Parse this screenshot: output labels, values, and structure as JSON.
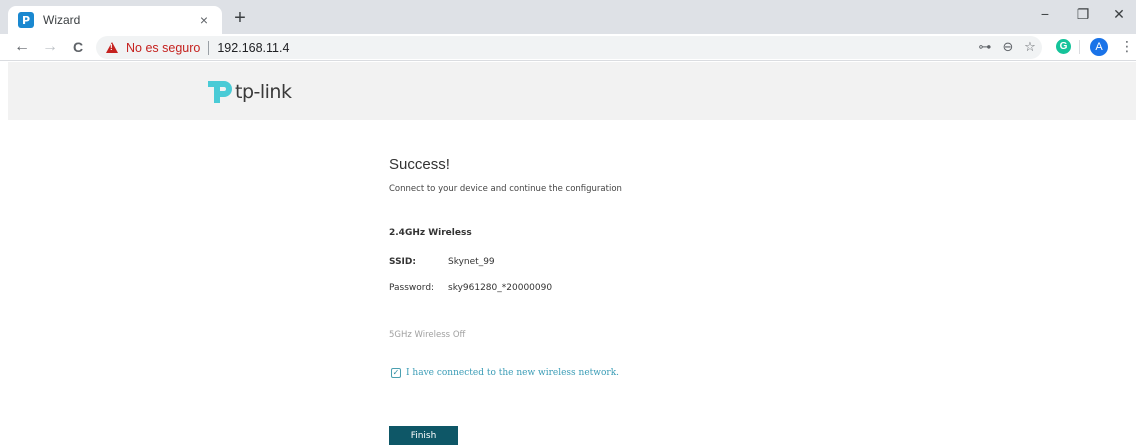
{
  "browser": {
    "tab_title": "Wizard",
    "tab_close": "×",
    "new_tab": "+",
    "window_controls": {
      "minimize": "−",
      "restore": "❐",
      "close": "✕"
    },
    "nav": {
      "back": "←",
      "forward": "→",
      "reload": "C"
    },
    "security_label": "No es seguro",
    "url": "192.168.11.4",
    "toolbar_icons": {
      "key": "⊶",
      "zoom": "⊖",
      "star": "☆",
      "extension": "G",
      "avatar": "A",
      "menu": "⋮"
    }
  },
  "header": {
    "logo_text": "tp-link"
  },
  "content": {
    "title": "Success!",
    "subtitle": "Connect to your device and continue the configuration",
    "section_title": "2.4GHz Wireless",
    "ssid_label": "SSID:",
    "ssid_value": "Skynet_99",
    "password_label": "Password:",
    "password_value": "sky961280_*20000090",
    "fiveghz_status": "5GHz Wireless Off",
    "checkbox_label": "I have connected to the new wireless network.",
    "checkbox_checked": true,
    "finish_label": "Finish"
  },
  "colors": {
    "accent": "#0e5767",
    "link": "#3a9cb6",
    "insecure": "#c5221f",
    "logo": "#4acbd6"
  }
}
